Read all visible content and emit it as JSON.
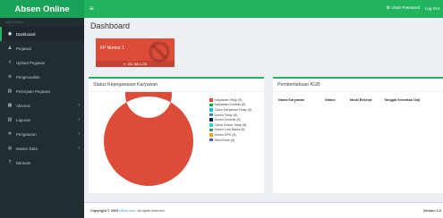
{
  "app": {
    "title": "Absen Online"
  },
  "topbar": {
    "menu_icon": "hamburger-icon",
    "change_password": "Ubah Password",
    "logout": "Log Out"
  },
  "sidebar": {
    "header": "MAIN MENU",
    "items": [
      {
        "label": "Dashboard",
        "icon": "dashboard-icon",
        "glyph": "◉",
        "active": true,
        "has_children": false
      },
      {
        "label": "Pegawai",
        "icon": "users-icon",
        "glyph": "♟",
        "active": false,
        "has_children": false
      },
      {
        "label": "Upload Pegawai",
        "icon": "upload-icon",
        "glyph": "⇪",
        "active": false,
        "has_children": false
      },
      {
        "label": "Pengecualian",
        "icon": "ban-icon",
        "glyph": "⊘",
        "active": false,
        "has_children": false
      },
      {
        "label": "Pekerjaan Pegawai",
        "icon": "briefcase-icon",
        "glyph": "▤",
        "active": false,
        "has_children": false
      },
      {
        "label": "Absensi",
        "icon": "calendar-icon",
        "glyph": "▦",
        "active": false,
        "has_children": true
      },
      {
        "label": "Laporan",
        "icon": "report-icon",
        "glyph": "▥",
        "active": false,
        "has_children": true
      },
      {
        "label": "Pengaturan",
        "icon": "gear-icon",
        "glyph": "✲",
        "active": false,
        "has_children": true
      },
      {
        "label": "Master Data",
        "icon": "database-icon",
        "glyph": "◍",
        "active": false,
        "has_children": true
      },
      {
        "label": "Bantuan",
        "icon": "help-icon",
        "glyph": "?",
        "active": false,
        "has_children": false
      }
    ]
  },
  "page": {
    "title": "Dashboard"
  },
  "infobox": {
    "label": "FP Nomor 1",
    "footer": "192.168.1.201",
    "icon": "ban-icon",
    "color": "#dd4b39"
  },
  "status_box": {
    "title": "Status Kepegawaian Karyawan"
  },
  "chart_data": {
    "type": "pie",
    "title": "Status Kepegawaian Karyawan",
    "legend_position": "right",
    "labels": [
      "Karyawan Tetap (8)",
      "Karyawan Kontrak (8)",
      "Calon Karyawan Tetap (8)",
      "Dosen Tetap (8)",
      "Dosen Kontrak (8)",
      "Calon Dosen Tetap (8)",
      "Dosen Luar Biasa (8)",
      "Dosen DPK (8)",
      "Nilai Dinas (8)"
    ],
    "values": [
      8,
      8,
      8,
      8,
      8,
      8,
      8,
      8,
      8
    ],
    "colors": [
      "#dd4b39",
      "#00a65a",
      "#00c0ef",
      "#3c8dbc",
      "#001f3f",
      "#39cccc",
      "#3d9970",
      "#f39c12",
      "#605ca8"
    ],
    "rendered_share": [
      1,
      0,
      0,
      0,
      0,
      0,
      0,
      0,
      0
    ]
  },
  "kgb_box": {
    "title": "Pemberitahuan KGB",
    "columns": [
      "Nama Karyawan",
      "Status",
      "Mulai Bekerja",
      "Tanggal Kenaikan Gaji"
    ]
  },
  "footer": {
    "copyright_prefix": "Copyright © 2020",
    "brand": "tafbro.com.",
    "rights": "All rights reserved.",
    "version": "Version 1.0"
  }
}
